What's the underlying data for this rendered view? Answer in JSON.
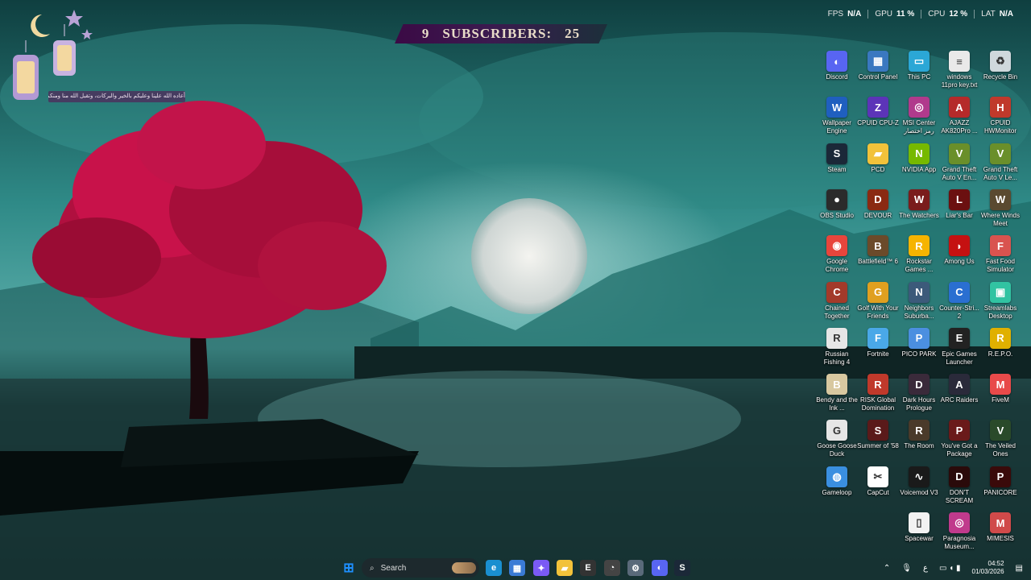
{
  "stats": [
    {
      "label": "FPS",
      "value": "N/A"
    },
    {
      "label": "GPU",
      "value": "11 %"
    },
    {
      "label": "CPU",
      "value": "12 %"
    },
    {
      "label": "LAT",
      "value": "N/A"
    }
  ],
  "banner": {
    "left": "9",
    "text": "SUBSCRIBERS:",
    "right": "25"
  },
  "arabic_note": "أعاده الله علينا وعليكم بالخير والبركات، وتقبل الله منا ومنكم",
  "icons": [
    {
      "label": "Discord",
      "icon": "discord-icon",
      "color": "#5865f2",
      "glyph": "◐"
    },
    {
      "label": "Control Panel",
      "icon": "control-panel-icon",
      "color": "#3a78c0",
      "glyph": "▦"
    },
    {
      "label": "This PC",
      "icon": "monitor-icon",
      "color": "#2ba7d6",
      "glyph": "▭"
    },
    {
      "label": "windows 11pro key.txt",
      "icon": "text-file-icon",
      "color": "#e9e9e9",
      "glyph": "≡"
    },
    {
      "label": "Recycle Bin",
      "icon": "recycle-bin-icon",
      "color": "#cfd8dc",
      "glyph": "♻"
    },
    {
      "label": "Wallpaper Engine",
      "icon": "wallpaper-engine-icon",
      "color": "#1f5fbf",
      "glyph": "W"
    },
    {
      "label": "CPUID CPU-Z",
      "icon": "cpuz-icon",
      "color": "#5c34b8",
      "glyph": "Z"
    },
    {
      "label": "MSI Center رمز اختصار",
      "icon": "msi-center-icon",
      "color": "#b03a8c",
      "glyph": "◎"
    },
    {
      "label": "AJAZZ AK820Pro ...",
      "icon": "ajazz-icon",
      "color": "#b52a2a",
      "glyph": "A"
    },
    {
      "label": "CPUID HWMonitor",
      "icon": "hwmonitor-icon",
      "color": "#c0392b",
      "glyph": "H"
    },
    {
      "label": "Steam",
      "icon": "steam-icon",
      "color": "#1b2838",
      "glyph": "S"
    },
    {
      "label": "PCD",
      "icon": "folder-icon",
      "color": "#f2c23a",
      "glyph": "▰"
    },
    {
      "label": "NVIDIA App",
      "icon": "nvidia-icon",
      "color": "#76b900",
      "glyph": "N"
    },
    {
      "label": "Grand Theft Auto V En...",
      "icon": "gta-icon",
      "color": "#6a8f2a",
      "glyph": "V"
    },
    {
      "label": "Grand Theft Auto V Le...",
      "icon": "gta-legacy-icon",
      "color": "#6a8f2a",
      "glyph": "V"
    },
    {
      "label": "OBS Studio",
      "icon": "obs-icon",
      "color": "#2b2b2b",
      "glyph": "●"
    },
    {
      "label": "DEVOUR",
      "icon": "devour-icon",
      "color": "#8a2a12",
      "glyph": "D"
    },
    {
      "label": "The Watchers",
      "icon": "watchers-icon",
      "color": "#7a1c1c",
      "glyph": "W"
    },
    {
      "label": "Liar's Bar",
      "icon": "liars-bar-icon",
      "color": "#6b1010",
      "glyph": "L"
    },
    {
      "label": "Where Winds Meet",
      "icon": "where-winds-meet-icon",
      "color": "#5a4a30",
      "glyph": "W"
    },
    {
      "label": "Google Chrome",
      "icon": "chrome-icon",
      "color": "#e8453c",
      "glyph": "◉"
    },
    {
      "label": "Battlefield™ 6",
      "icon": "battlefield-icon",
      "color": "#6b4a2a",
      "glyph": "B"
    },
    {
      "label": "Rockstar Games ...",
      "icon": "rockstar-icon",
      "color": "#f6b400",
      "glyph": "R"
    },
    {
      "label": "Among Us",
      "icon": "among-us-icon",
      "color": "#c51111",
      "glyph": "◗"
    },
    {
      "label": "Fast Food Simulator",
      "icon": "fast-food-icon",
      "color": "#d9534f",
      "glyph": "F"
    },
    {
      "label": "Chained Together",
      "icon": "chained-together-icon",
      "color": "#a33a2a",
      "glyph": "C"
    },
    {
      "label": "Golf With Your Friends",
      "icon": "golf-icon",
      "color": "#e0a020",
      "glyph": "G"
    },
    {
      "label": "Neighbors Suburba...",
      "icon": "neighbors-icon",
      "color": "#3c5a7a",
      "glyph": "N"
    },
    {
      "label": "Counter-Stri... 2",
      "icon": "counter-strike-icon",
      "color": "#2a6fd1",
      "glyph": "C"
    },
    {
      "label": "Streamlabs Desktop",
      "icon": "streamlabs-icon",
      "color": "#31c3a2",
      "glyph": "▣"
    },
    {
      "label": "Russian Fishing 4",
      "icon": "russian-fishing-icon",
      "color": "#e6e6e6",
      "glyph": "R"
    },
    {
      "label": "Fortnite",
      "icon": "fortnite-icon",
      "color": "#4aa8e8",
      "glyph": "F"
    },
    {
      "label": "PICO PARK",
      "icon": "pico-park-icon",
      "color": "#4b8fe0",
      "glyph": "P"
    },
    {
      "label": "Epic Games Launcher",
      "icon": "epic-games-icon",
      "color": "#222222",
      "glyph": "E"
    },
    {
      "label": "R.E.P.O.",
      "icon": "repo-icon",
      "color": "#e0b000",
      "glyph": "R"
    },
    {
      "label": "Bendy and the Ink ...",
      "icon": "bendy-icon",
      "color": "#d8c8a0",
      "glyph": "B"
    },
    {
      "label": "RISK Global Domination",
      "icon": "risk-icon",
      "color": "#c0392b",
      "glyph": "R"
    },
    {
      "label": "Dark Hours Prologue",
      "icon": "dark-hours-icon",
      "color": "#3a2a3a",
      "glyph": "D"
    },
    {
      "label": "ARC Raiders",
      "icon": "arc-raiders-icon",
      "color": "#2a2a3a",
      "glyph": "A"
    },
    {
      "label": "FiveM",
      "icon": "fivem-icon",
      "color": "#e84a4a",
      "glyph": "M"
    },
    {
      "label": "Goose Goose Duck",
      "icon": "goose-goose-duck-icon",
      "color": "#e6e6e6",
      "glyph": "G"
    },
    {
      "label": "Summer of '58",
      "icon": "summer-58-icon",
      "color": "#5a1a1a",
      "glyph": "S"
    },
    {
      "label": "The Room",
      "icon": "the-room-icon",
      "color": "#4a3a2a",
      "glyph": "R"
    },
    {
      "label": "You've Got a Package",
      "icon": "package-icon",
      "color": "#6a1a1a",
      "glyph": "P"
    },
    {
      "label": "The Veiled Ones",
      "icon": "veiled-ones-icon",
      "color": "#2a4a2a",
      "glyph": "V"
    },
    {
      "label": "Gameloop",
      "icon": "gameloop-icon",
      "color": "#3a8fe0",
      "glyph": "◍"
    },
    {
      "label": "CapCut",
      "icon": "capcut-icon",
      "color": "#ffffff",
      "glyph": "✂"
    },
    {
      "label": "Voicemod V3",
      "icon": "voicemod-icon",
      "color": "#1a1a1a",
      "glyph": "∿"
    },
    {
      "label": "DON'T SCREAM",
      "icon": "dont-scream-icon",
      "color": "#2a0a0a",
      "glyph": "D"
    },
    {
      "label": "PANICORE",
      "icon": "panicore-icon",
      "color": "#3a0a0a",
      "glyph": "P"
    },
    {
      "label": "Spacewar",
      "icon": "spacewar-icon",
      "color": "#f2f2f2",
      "glyph": "▯"
    },
    {
      "label": "Paragnosia Museum...",
      "icon": "paragnosia-icon",
      "color": "#c03a8c",
      "glyph": "◎"
    },
    {
      "label": "MIMESIS",
      "icon": "mimesis-icon",
      "color": "#d04a4a",
      "glyph": "M"
    }
  ],
  "taskbar": {
    "search_label": "Search",
    "apps": [
      {
        "name": "start-button-icon",
        "color": "#1e90ff",
        "glyph": "⊞"
      },
      {
        "name": "edge-icon",
        "color": "#1a8fd0",
        "glyph": "e"
      },
      {
        "name": "microsoft-store-icon",
        "color": "#3a7bd5",
        "glyph": "▦"
      },
      {
        "name": "copilot-icon",
        "color": "#7a5af5",
        "glyph": "✦"
      },
      {
        "name": "file-explorer-icon",
        "color": "#f2c23a",
        "glyph": "▰"
      },
      {
        "name": "epic-games-taskbar-icon",
        "color": "#333333",
        "glyph": "E"
      },
      {
        "name": "rockstar-taskbar-icon",
        "color": "#444444",
        "glyph": "◔"
      },
      {
        "name": "settings-icon",
        "color": "#5a6a7a",
        "glyph": "⚙"
      },
      {
        "name": "discord-taskbar-icon",
        "color": "#5865f2",
        "glyph": "◐"
      },
      {
        "name": "steam-taskbar-icon",
        "color": "#1b2838",
        "glyph": "S"
      }
    ]
  },
  "tray": {
    "lang": "ع",
    "time": "04:52",
    "date": "01/03/2026"
  }
}
